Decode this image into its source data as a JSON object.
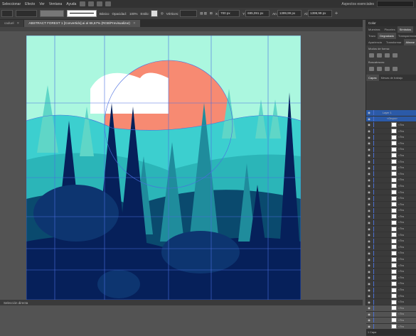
{
  "menu": {
    "items": [
      "Seleccionar",
      "Efecto",
      "Ver",
      "Ventana",
      "Ayuda"
    ],
    "workspace": "Aspectos esenciales"
  },
  "control_bar": {
    "stroke_profile": "Básico",
    "opacity_label": "Opacidad:",
    "opacity_value": "100%",
    "style_label": "Estilo:",
    "vertices_label": "Vértices:",
    "x_value": "700 px",
    "y_value": "695,091 px",
    "w_value": "1399,99 px",
    "h_value": "1399,99 px"
  },
  "tabs": [
    {
      "label": "caduel",
      "active": false
    },
    {
      "label": "ABSTRACT FOREST 1 [Convertido].ai al 66,67% (RGB/Previsualizar)",
      "active": true
    }
  ],
  "status": {
    "tool": "Selección directa"
  },
  "panels": {
    "color_title": "Color",
    "tabs_row1": [
      "Muestras",
      "Pinceles",
      "Símbolos"
    ],
    "tabs_row2": [
      "Trazo",
      "Degradado",
      "Transparencia"
    ],
    "tabs_row3": [
      "Apariencia",
      "Transformar",
      "Alinear"
    ],
    "pathfinder_modes_label": "Modos de forma:",
    "pathfinder_label": "Buscatrazos:",
    "layers_tabs": [
      "Capas",
      "Mesas de trabajo"
    ],
    "layer_name": "Layer 1",
    "group_name": "<Grupo>",
    "sublayer_label": "<Tra",
    "layers_footer": "1 Capa"
  },
  "colors": {
    "sky": "#ABF7DF",
    "sun": "#F78A72",
    "teal": "#3CCFCF",
    "navy": "#06205A",
    "selection": "#4A6EE0"
  }
}
